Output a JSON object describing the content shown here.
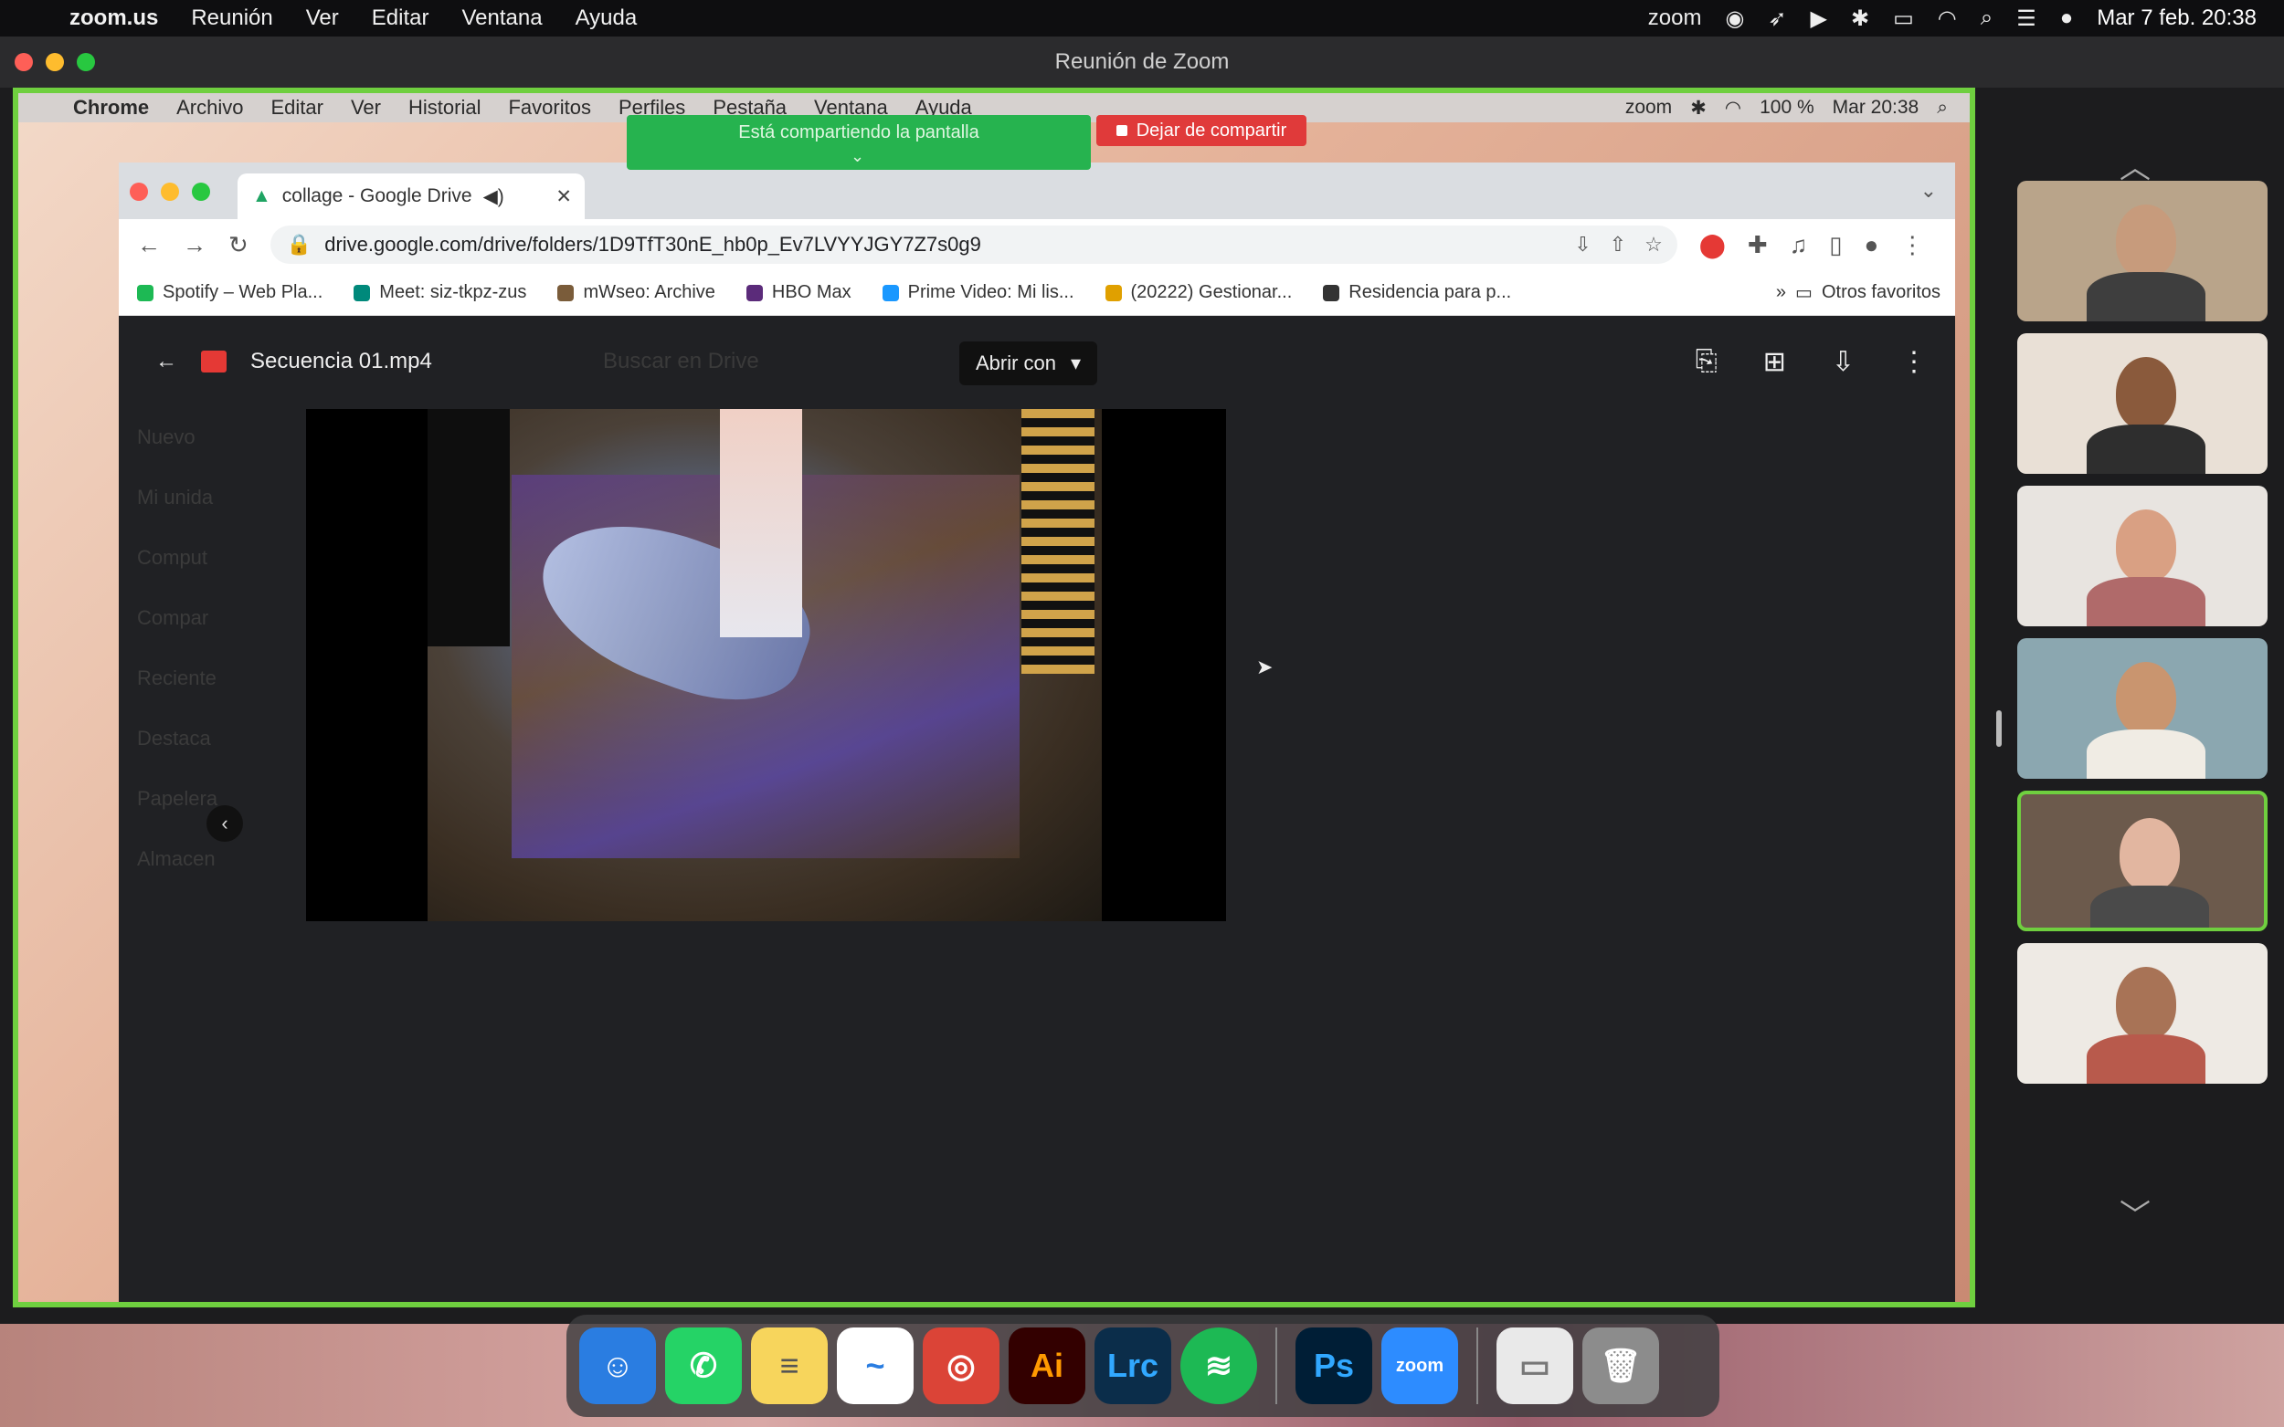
{
  "mac_menubar": {
    "app": "zoom.us",
    "items": [
      "Reunión",
      "Ver",
      "Editar",
      "Ventana",
      "Ayuda"
    ],
    "status": {
      "zoom_label": "zoom",
      "datetime": "Mar 7 feb.  20:38"
    }
  },
  "zoom": {
    "window_title": "Reunión de Zoom",
    "share_banner": "Está compartiendo la pantalla",
    "stop_share": "Dejar de compartir"
  },
  "inner_menubar": {
    "app": "Chrome",
    "items": [
      "Archivo",
      "Editar",
      "Ver",
      "Historial",
      "Favoritos",
      "Perfiles",
      "Pestaña",
      "Ventana",
      "Ayuda"
    ],
    "status": {
      "zoom_label": "zoom",
      "battery": "100 %",
      "time": "Mar 20:38"
    }
  },
  "chrome": {
    "tab_title": "collage - Google Drive",
    "url": "drive.google.com/drive/folders/1D9TfT30nE_hb0p_Ev7LVYYJGY7Z7s0g9",
    "bookmarks": [
      {
        "label": "Spotify – Web Pla...",
        "color": "#1db954"
      },
      {
        "label": "Meet: siz-tkpz-zus",
        "color": "#00897b"
      },
      {
        "label": "mWseo: Archive",
        "color": "#7a5c3a"
      },
      {
        "label": "HBO Max",
        "color": "#5b2b7a"
      },
      {
        "label": "Prime Video: Mi lis...",
        "color": "#1a98ff"
      },
      {
        "label": "(20222) Gestionar...",
        "color": "#e0a000"
      },
      {
        "label": "Residencia para p...",
        "color": "#333333"
      }
    ],
    "other_bookmarks": "Otros favoritos"
  },
  "drive": {
    "file_name": "Secuencia 01.mp4",
    "open_with": "Abrir con",
    "search_placeholder": "Buscar en Drive",
    "dim_sidebar": [
      "Nuevo",
      "Mi unida",
      "Comput",
      "Compar",
      "Reciente",
      "Destaca",
      "Papelera",
      "Almacen"
    ]
  },
  "dock": {
    "apps": [
      {
        "name": "Finder",
        "label": "☺",
        "color": "#2a7de1"
      },
      {
        "name": "WhatsApp",
        "label": "✆",
        "color": "#25d366"
      },
      {
        "name": "Notes",
        "label": "≡",
        "color": "#f7d55c"
      },
      {
        "name": "Freeform",
        "label": "~",
        "color": "#ffffff"
      },
      {
        "name": "Chrome",
        "label": "◎",
        "color": "#db4437"
      },
      {
        "name": "Illustrator",
        "label": "Ai",
        "color": "#330000"
      },
      {
        "name": "Lightroom Classic",
        "label": "Lrc",
        "color": "#0b2d4a"
      },
      {
        "name": "Spotify",
        "label": "≋",
        "color": "#1db954"
      },
      {
        "name": "Photoshop",
        "label": "Ps",
        "color": "#001e36"
      },
      {
        "name": "Zoom",
        "label": "zoom",
        "color": "#2d8cff"
      },
      {
        "name": "Preview window",
        "label": "▭",
        "color": "#e9e9e9"
      },
      {
        "name": "Trash",
        "label": "🗑",
        "color": "#8c8c8c"
      }
    ]
  },
  "participants": [
    {
      "bg": "#b9a48a",
      "skin": "#c79b7c",
      "shirt": "#3e3e3e"
    },
    {
      "bg": "#e9e0d6",
      "skin": "#8a5a3c",
      "shirt": "#2e2e2e"
    },
    {
      "bg": "#e8e4e0",
      "skin": "#d9a083",
      "shirt": "#b06a6a"
    },
    {
      "bg": "#8ba7b0",
      "skin": "#c9956f",
      "shirt": "#f0ece4"
    },
    {
      "bg": "#6c5a4c",
      "skin": "#e2b6a0",
      "shirt": "#4a4a4a"
    },
    {
      "bg": "#eeeae4",
      "skin": "#a87356",
      "shirt": "#b85a4c"
    }
  ]
}
